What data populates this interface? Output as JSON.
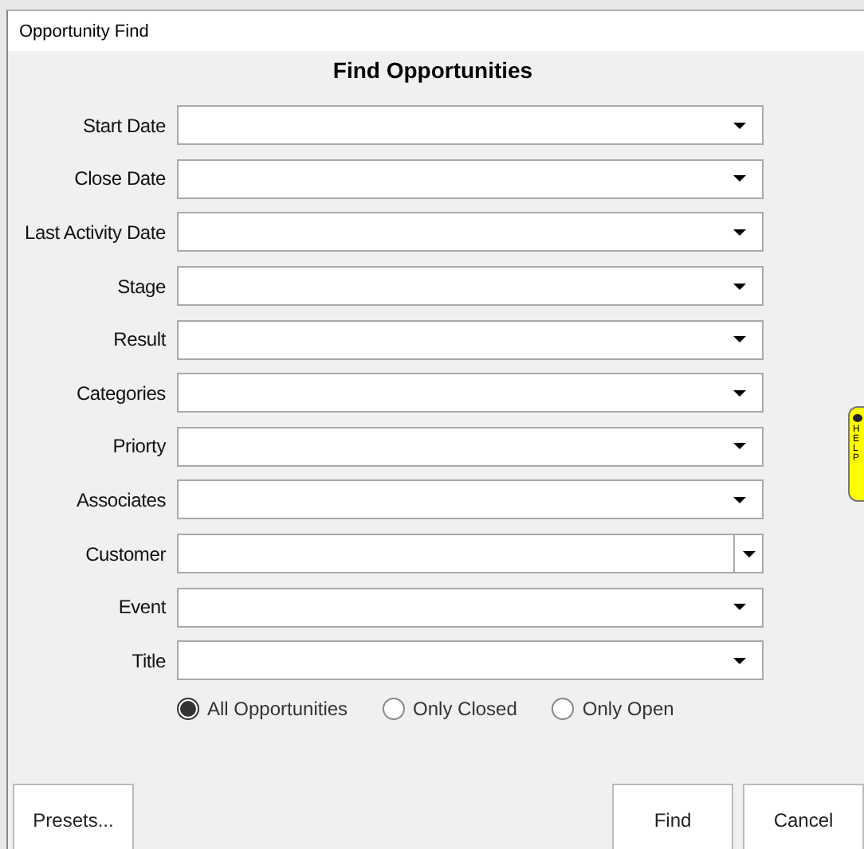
{
  "window": {
    "title": "Opportunity Find"
  },
  "heading": "Find Opportunities",
  "fields": [
    {
      "label": "Start Date",
      "kind": "dropdown"
    },
    {
      "label": "Close Date",
      "kind": "dropdown"
    },
    {
      "label": "Last Activity Date",
      "kind": "dropdown"
    },
    {
      "label": "Stage",
      "kind": "dropdown"
    },
    {
      "label": "Result",
      "kind": "dropdown"
    },
    {
      "label": "Categories",
      "kind": "dropdown"
    },
    {
      "label": "Priorty",
      "kind": "dropdown"
    },
    {
      "label": "Associates",
      "kind": "dropdown"
    },
    {
      "label": "Customer",
      "kind": "split"
    },
    {
      "label": "Event",
      "kind": "dropdown"
    },
    {
      "label": "Title",
      "kind": "dropdown"
    }
  ],
  "filter": [
    {
      "label": "All Opportunities",
      "selected": true
    },
    {
      "label": "Only Closed",
      "selected": false
    },
    {
      "label": "Only Open",
      "selected": false
    }
  ],
  "help_tab": {
    "label": "HELP"
  },
  "buttons": {
    "left": [
      "Presets..."
    ],
    "right": [
      "Find",
      "Cancel"
    ]
  }
}
